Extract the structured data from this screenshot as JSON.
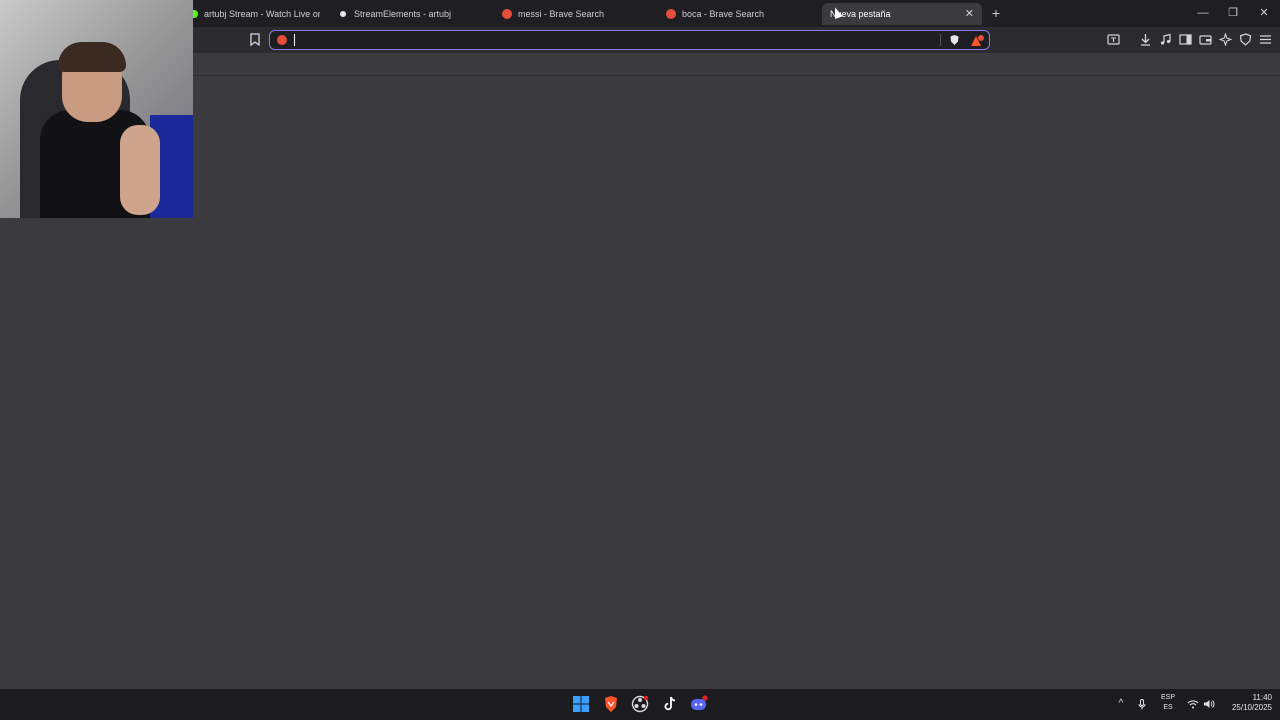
{
  "tabs": [
    {
      "title": "artubj Stream - Watch Live on Ki",
      "favicon": "kick-icon",
      "active": false
    },
    {
      "title": "StreamElements - artubj",
      "favicon": "streamelements-icon",
      "active": false
    },
    {
      "title": "messi - Brave Search",
      "favicon": "brave-search-icon",
      "active": false
    },
    {
      "title": "boca - Brave Search",
      "favicon": "brave-search-icon",
      "active": false
    },
    {
      "title": "Nueva pestaña",
      "favicon": "none",
      "active": true
    }
  ],
  "tab_close_label": "✕",
  "new_tab_label": "+",
  "window_controls": {
    "minimize": "—",
    "maximize": "❐",
    "close": "✕"
  },
  "address_bar": {
    "value": "",
    "placeholder": ""
  },
  "taskbar": {
    "icons": [
      "windows-start-icon",
      "brave-icon",
      "obs-icon",
      "tiktok-icon",
      "discord-icon"
    ],
    "tray": {
      "lang_top": "ESP",
      "lang_bottom": "ES",
      "time": "11:40",
      "date": "25/10/2025"
    }
  },
  "colors": {
    "accent": "#8a7cf0",
    "brave_orange": "#fb542b",
    "background": "#3a3a3f"
  }
}
